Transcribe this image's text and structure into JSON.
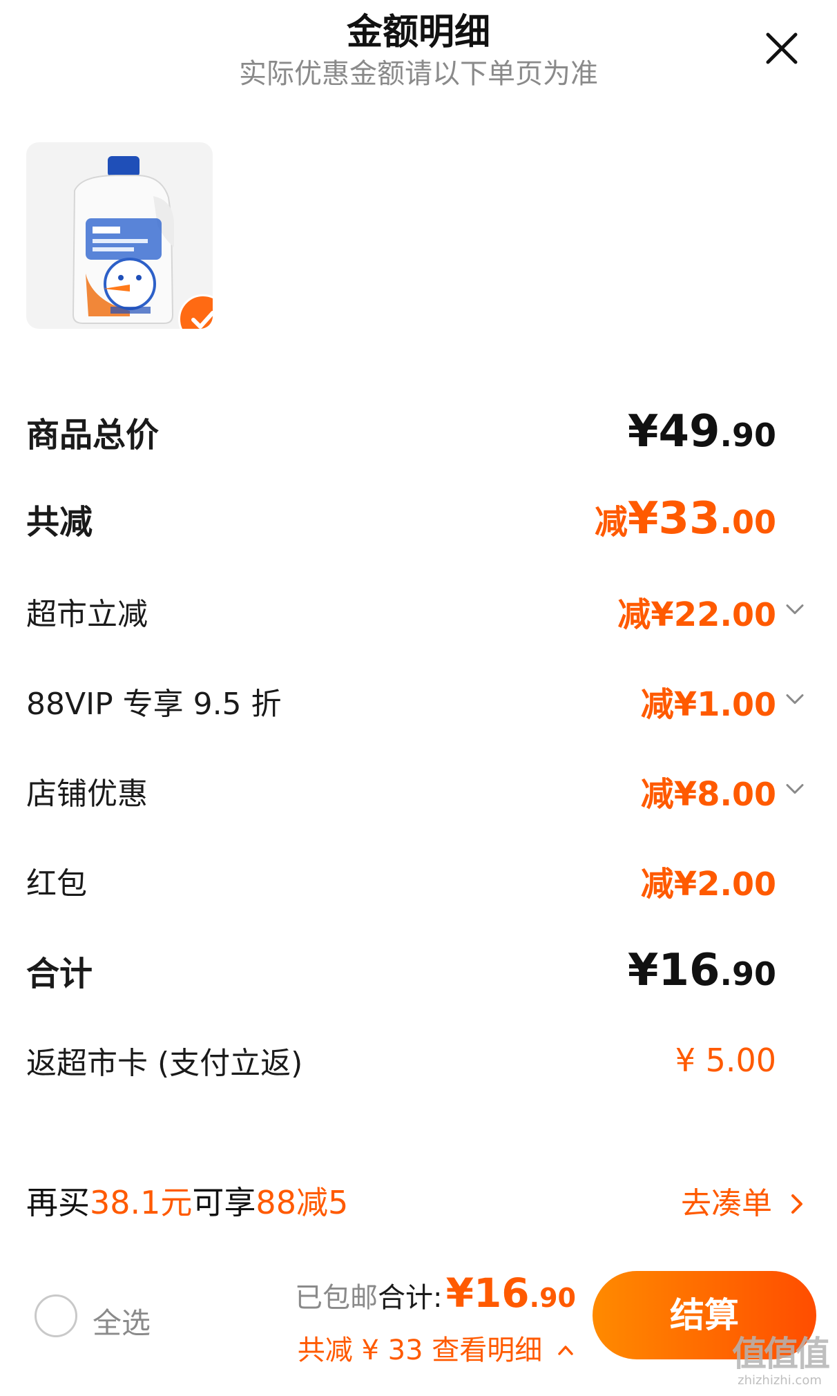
{
  "header": {
    "title": "金额明细",
    "subtitle": "实际优惠金额请以下单页为准"
  },
  "icons": {
    "close": "close-icon",
    "check": "check-icon",
    "chevron": "chevron-down-icon",
    "chevron_right": "chevron-right-icon",
    "chevron_up": "chevron-up-icon"
  },
  "product": {
    "image": "laundry-detergent-bottle",
    "selected": true
  },
  "breakdown": {
    "subtotal": {
      "label": "商品总价",
      "yuan": "¥49",
      "cents": ".90"
    },
    "discount_total": {
      "label": "共减",
      "prefix": "减",
      "yuan": "¥33",
      "cents": ".00"
    },
    "items": [
      {
        "label": "超市立减",
        "prefix": "减",
        "yuan": "¥22",
        "cents": ".00",
        "expandable": true
      },
      {
        "label": "88VIP 专享 9.5 折",
        "prefix": "减",
        "yuan": "¥1",
        "cents": ".00",
        "expandable": true
      },
      {
        "label": "店铺优惠",
        "prefix": "减",
        "yuan": "¥8",
        "cents": ".00",
        "expandable": true
      },
      {
        "label": "红包",
        "prefix": "减",
        "yuan": "¥2",
        "cents": ".00",
        "expandable": false
      }
    ],
    "total": {
      "label": "合计",
      "yuan": "¥16",
      "cents": ".90"
    },
    "rebate": {
      "label": "返超市卡 (支付立返)",
      "value": "¥ 5.00"
    }
  },
  "promo": {
    "text_1": "再买",
    "amount": "38.1元",
    "text_2": "可享",
    "deal": "88减5",
    "link": "去凑单"
  },
  "bottom_bar": {
    "select_all": "全选",
    "shipped": "已包邮",
    "total_label": "合计:",
    "total_yuan": "¥16",
    "total_cents": ".90",
    "saved": "共减 ¥ 33 查看明细",
    "checkout": "结算"
  },
  "watermark": {
    "glyphs": "值值值",
    "url": "zhizhizhi.com"
  },
  "colors": {
    "accent": "#ff5a00",
    "button_gradient_start": "#ff8a00",
    "button_gradient_end": "#ff4d00",
    "muted": "#8a8a8a"
  }
}
